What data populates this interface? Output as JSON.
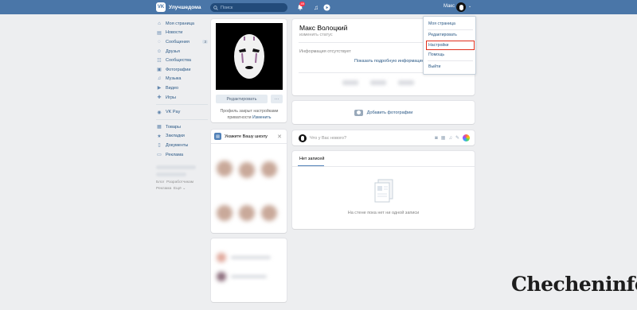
{
  "header": {
    "logo_text": "VK",
    "app_title": "Улучшедома",
    "search_placeholder": "Поиск",
    "notification_count": "49",
    "user_name": "Макс"
  },
  "sidebar": {
    "items": [
      {
        "label": "Моя страница",
        "icon": "home-icon"
      },
      {
        "label": "Новости",
        "icon": "news-icon"
      },
      {
        "label": "Сообщения",
        "icon": "messages-icon",
        "count": "3"
      },
      {
        "label": "Друзья",
        "icon": "friends-icon"
      },
      {
        "label": "Сообщества",
        "icon": "communities-icon"
      },
      {
        "label": "Фотографии",
        "icon": "photos-icon"
      },
      {
        "label": "Музыка",
        "icon": "music-icon"
      },
      {
        "label": "Видео",
        "icon": "video-icon"
      },
      {
        "label": "Игры",
        "icon": "games-icon"
      }
    ],
    "pay": "VK Pay",
    "items2": [
      {
        "label": "Товары",
        "icon": "goods-icon"
      },
      {
        "label": "Закладки",
        "icon": "bookmarks-icon"
      },
      {
        "label": "Документы",
        "icon": "documents-icon"
      },
      {
        "label": "Реклама",
        "icon": "ads-icon"
      }
    ],
    "footer": [
      "Блог",
      "Разработчикам",
      "Реклама",
      "Ещё ⌄"
    ]
  },
  "profile": {
    "edit_label": "Редактировать",
    "more_label": "···",
    "privacy_text": "Профиль закрыт настройками приватности",
    "privacy_link": "Изменить",
    "name": "Макс Волоцкий",
    "status": "изменить статус",
    "info_missing": "Информация отсутствует",
    "show_info": "Показать подробную информацию",
    "add_photo": "Добавить фотографии",
    "post_placeholder": "Что у Вас нового?",
    "wall_tab": "Нет записей",
    "wall_empty": "На стене пока нет ни одной записи"
  },
  "school": {
    "title": "Укажите Вашу школу"
  },
  "dropdown": {
    "items": [
      "Моя страница",
      "Редактировать",
      "Настройки",
      "Помощь",
      "Выйти"
    ],
    "highlighted": "Настройки",
    "highlight_color": "#e0301e"
  },
  "watermark": "Checheninfo",
  "colors": {
    "header_bg": "#4a76a8",
    "link": "#2a5885",
    "page_bg": "#edeef0"
  }
}
